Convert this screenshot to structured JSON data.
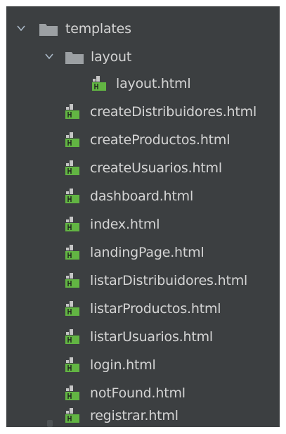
{
  "colors": {
    "panel_bg": "#3c3f41",
    "text": "#d4d4d4",
    "folder": "#9ca0a3",
    "html_file_green": "#62b543",
    "html_file_gray": "#c5c5c5"
  },
  "tree": {
    "root_folder": {
      "label": "templates",
      "expanded": true,
      "icon": "folder-icon"
    },
    "sub_folder": {
      "label": "layout",
      "expanded": true,
      "icon": "folder-icon"
    },
    "sub_folder_files": [
      {
        "label": "layout.html",
        "icon": "html-file-icon"
      }
    ],
    "files": [
      {
        "label": "createDistribuidores.html",
        "icon": "html-file-icon"
      },
      {
        "label": "createProductos.html",
        "icon": "html-file-icon"
      },
      {
        "label": "createUsuarios.html",
        "icon": "html-file-icon"
      },
      {
        "label": "dashboard.html",
        "icon": "html-file-icon"
      },
      {
        "label": "index.html",
        "icon": "html-file-icon"
      },
      {
        "label": "landingPage.html",
        "icon": "html-file-icon"
      },
      {
        "label": "listarDistribuidores.html",
        "icon": "html-file-icon"
      },
      {
        "label": "listarProductos.html",
        "icon": "html-file-icon"
      },
      {
        "label": "listarUsuarios.html",
        "icon": "html-file-icon"
      },
      {
        "label": "login.html",
        "icon": "html-file-icon"
      },
      {
        "label": "notFound.html",
        "icon": "html-file-icon"
      },
      {
        "label": "registrar.html",
        "icon": "html-file-icon"
      }
    ]
  }
}
